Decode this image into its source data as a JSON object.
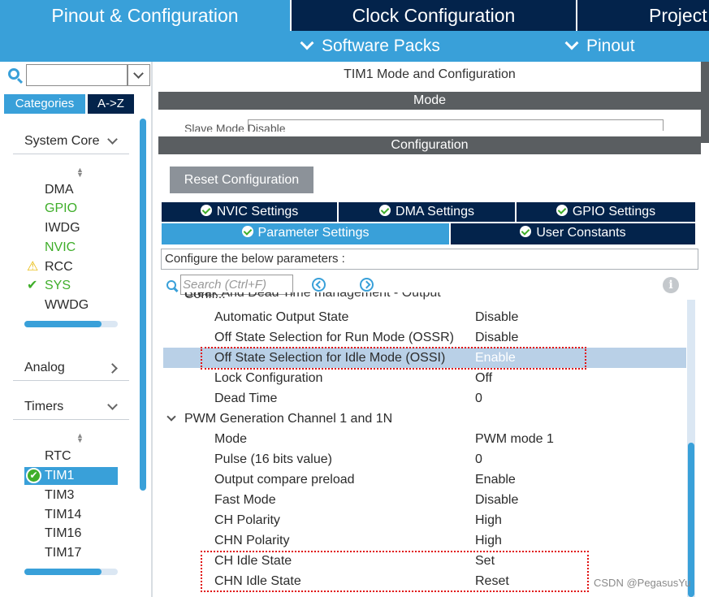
{
  "top_tabs": {
    "pinout_config": "Pinout & Configuration",
    "clock_config": "Clock Configuration",
    "project": "Project"
  },
  "sub_menu": {
    "software_packs": "Software Packs",
    "pinout": "Pinout"
  },
  "left": {
    "search_value": "",
    "tab_categories": "Categories",
    "tab_az": "A->Z",
    "system_core": {
      "title": "System Core",
      "items": [
        "DMA",
        "GPIO",
        "IWDG",
        "NVIC",
        "RCC",
        "SYS",
        "WWDG"
      ]
    },
    "analog": {
      "title": "Analog"
    },
    "timers": {
      "title": "Timers",
      "items": [
        "RTC",
        "TIM1",
        "TIM3",
        "TIM14",
        "TIM16",
        "TIM17"
      ]
    }
  },
  "main": {
    "title": "TIM1 Mode and Configuration",
    "mode_bar": "Mode",
    "mode_cut_text": "Slave Mode   Disable",
    "config_bar": "Configuration",
    "reset_button": "Reset Configuration",
    "tabs": {
      "nvic": "NVIC Settings",
      "dma": "DMA Settings",
      "gpio": "GPIO Settings",
      "param": "Parameter Settings",
      "user": "User Constants"
    },
    "configure_label": "Configure the below parameters :",
    "search_placeholder": "Search (Ctrl+F)",
    "cut_group": "Break And Dead Time management - Output Confi...",
    "params": [
      {
        "name": "Automatic Output State",
        "value": "Disable"
      },
      {
        "name": "Off State Selection for Run Mode (OSSR)",
        "value": "Disable"
      },
      {
        "name": "Off State Selection for Idle Mode (OSSI)",
        "value": "Enable"
      },
      {
        "name": "Lock Configuration",
        "value": "Off"
      },
      {
        "name": "Dead Time",
        "value": "0"
      }
    ],
    "group_pwm": "PWM Generation Channel 1 and 1N",
    "pwm_params": [
      {
        "name": "Mode",
        "value": "PWM mode 1"
      },
      {
        "name": "Pulse (16 bits value)",
        "value": "0"
      },
      {
        "name": "Output compare preload",
        "value": "Enable"
      },
      {
        "name": "Fast Mode",
        "value": "Disable"
      },
      {
        "name": "CH Polarity",
        "value": "High"
      },
      {
        "name": "CHN Polarity",
        "value": "High"
      },
      {
        "name": "CH Idle State",
        "value": "Set"
      },
      {
        "name": "CHN Idle State",
        "value": "Reset"
      }
    ]
  },
  "watermark": "CSDN @PegasusYu",
  "colors": {
    "accent_blue": "#39a0d9",
    "dark_navy": "#03234b",
    "bar_gray": "#5a5e61",
    "ok_green": "#3fae2a",
    "highlight_row": "#b9d0e7",
    "annotation_red": "#e01010"
  }
}
